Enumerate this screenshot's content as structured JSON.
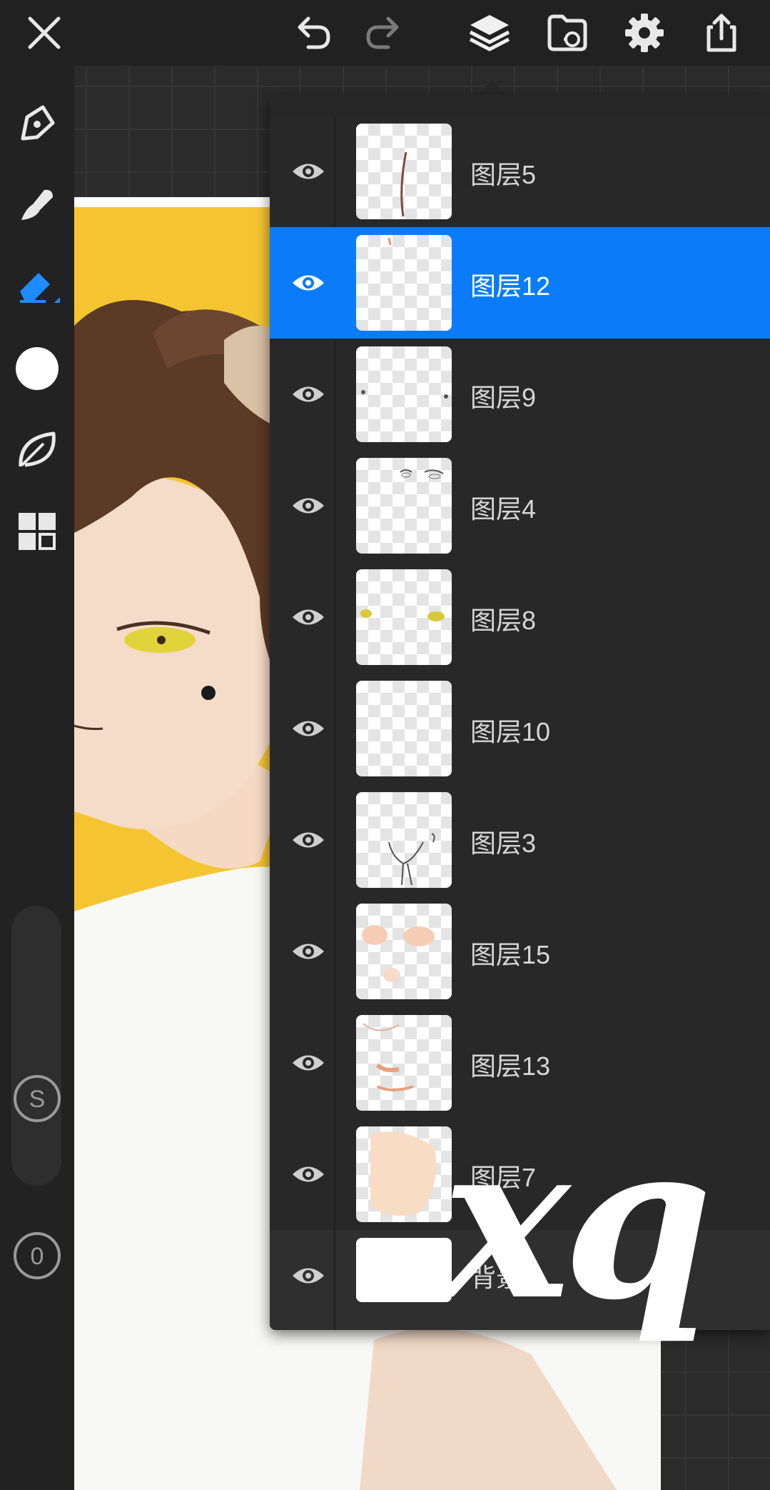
{
  "toolbar": {
    "icons": [
      "close-icon",
      "undo-icon",
      "redo-icon",
      "layers-icon",
      "import-icon",
      "settings-icon",
      "share-icon"
    ]
  },
  "tools": {
    "icons": [
      "pen-icon",
      "smudge-icon",
      "eraser-icon",
      "color-swatch",
      "leaf-icon",
      "gallery-icon"
    ],
    "size_label": "S",
    "opacity_label": "0",
    "active_color": "#ffffff",
    "active_tool_color": "#1e8cff"
  },
  "layers_panel": {
    "toolbar_icons": [
      "add-layer-icon",
      "folder-icon",
      "lock-icon",
      "merge-down-icon",
      "alpha-checker-icon",
      "blend-mode-icon"
    ],
    "selected_color": "#0a7cf9",
    "layers": [
      {
        "name": "图层5",
        "visible": true,
        "selected": false
      },
      {
        "name": "图层12",
        "visible": true,
        "selected": true
      },
      {
        "name": "图层9",
        "visible": true,
        "selected": false
      },
      {
        "name": "图层4",
        "visible": true,
        "selected": false
      },
      {
        "name": "图层8",
        "visible": true,
        "selected": false
      },
      {
        "name": "图层10",
        "visible": true,
        "selected": false
      },
      {
        "name": "图层3",
        "visible": true,
        "selected": false
      },
      {
        "name": "图层15",
        "visible": true,
        "selected": false
      },
      {
        "name": "图层13",
        "visible": true,
        "selected": false
      },
      {
        "name": "图层7",
        "visible": true,
        "selected": false
      },
      {
        "name": "背景",
        "visible": true,
        "selected": false
      }
    ]
  },
  "watermark": "xq"
}
